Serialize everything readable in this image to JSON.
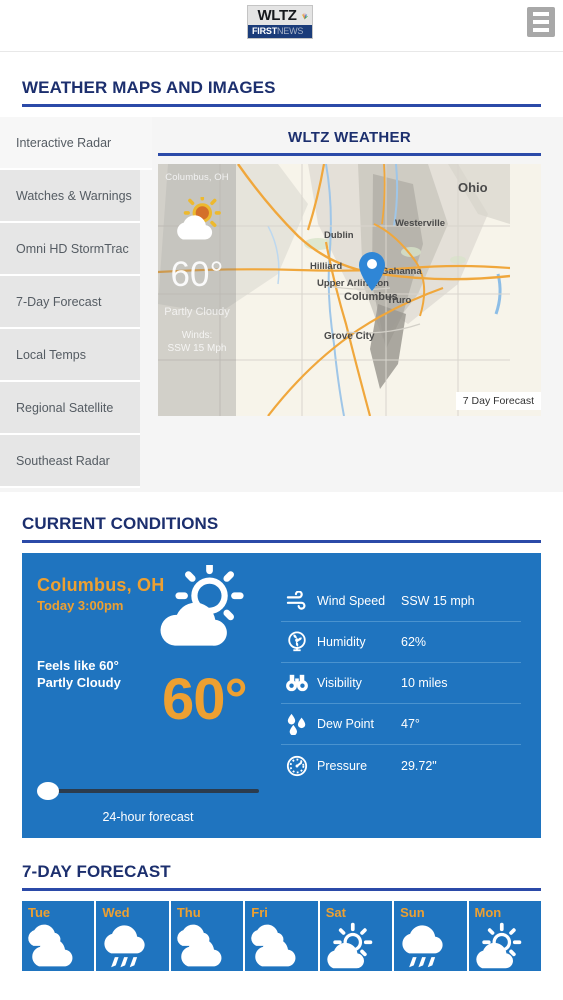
{
  "header": {
    "logo": {
      "brand": "WLTZ",
      "first": "FIRST",
      "news": "NEWS",
      "peacock_icon": "nbc-peacock-icon"
    },
    "menu_icon": "hamburger-menu-icon"
  },
  "maps_section": {
    "title": "WEATHER MAPS AND IMAGES",
    "tabs": [
      {
        "label": "Interactive Radar",
        "active": true
      },
      {
        "label": "Watches & Warnings",
        "active": false
      },
      {
        "label": "Omni HD StormTrac",
        "active": false
      },
      {
        "label": "7-Day Forecast",
        "active": false
      },
      {
        "label": "Local Temps",
        "active": false
      },
      {
        "label": "Regional Satellite",
        "active": false
      },
      {
        "label": "Southeast Radar",
        "active": false
      }
    ],
    "panel_title": "WLTZ WEATHER",
    "map": {
      "overlay": {
        "city": "Columbus, OH",
        "icon": "sun-behind-cloud-icon",
        "temp": "60°",
        "condition": "Partly Cloudy",
        "wind_label": "Winds:",
        "wind_value": "SSW 15 Mph"
      },
      "badge": "7 Day Forecast",
      "state_label": "Ohio",
      "places": [
        "Westerville",
        "Dublin",
        "Gahanna",
        "Hilliard",
        "Upper Arlington",
        "Columbus",
        "Truro",
        "Grove City"
      ],
      "marker_icon": "map-pin-icon"
    }
  },
  "current_conditions": {
    "title": "CURRENT CONDITIONS",
    "city": "Columbus, OH",
    "time": "Today 3:00pm",
    "feels_like": "Feels like 60°",
    "condition": "Partly Cloudy",
    "icon": "sun-behind-cloud-icon",
    "temperature": "60°",
    "slider_label": "24-hour forecast",
    "metrics": [
      {
        "icon": "wind-icon",
        "label": "Wind Speed",
        "value": "SSW 15 mph"
      },
      {
        "icon": "humidity-icon",
        "label": "Humidity",
        "value": "62%"
      },
      {
        "icon": "binoculars-icon",
        "label": "Visibility",
        "value": "10 miles"
      },
      {
        "icon": "droplets-icon",
        "label": "Dew Point",
        "value": "47°"
      },
      {
        "icon": "gauge-icon",
        "label": "Pressure",
        "value": "29.72\""
      }
    ]
  },
  "forecast": {
    "title": "7-DAY FORECAST",
    "days": [
      {
        "name": "Tue",
        "icon": "partly-cloudy-icon"
      },
      {
        "name": "Wed",
        "icon": "rain-icon"
      },
      {
        "name": "Thu",
        "icon": "partly-cloudy-icon"
      },
      {
        "name": "Fri",
        "icon": "partly-cloudy-icon"
      },
      {
        "name": "Sat",
        "icon": "sun-behind-cloud-icon"
      },
      {
        "name": "Sun",
        "icon": "rain-icon"
      },
      {
        "name": "Mon",
        "icon": "sun-behind-cloud-icon"
      }
    ]
  },
  "colors": {
    "brand_blue": "#1f74bf",
    "navy": "#1c2f6e",
    "rule_blue": "#2b4aa8",
    "accent_orange": "#eda031",
    "tab_gray": "#e6e6e6"
  }
}
